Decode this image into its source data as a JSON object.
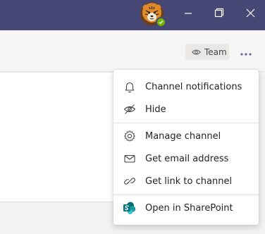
{
  "team_button": {
    "label": "Team",
    "icon": "eye-icon"
  },
  "more_button": {
    "icon": "more-dots-icon"
  },
  "presence": {
    "status_color": "#6bb700"
  },
  "menu": {
    "items": [
      {
        "label": "Channel notifications",
        "icon": "bell-icon"
      },
      {
        "label": "Hide",
        "icon": "eye-off-icon"
      },
      {
        "label": "Manage channel",
        "icon": "gear-icon"
      },
      {
        "label": "Get email address",
        "icon": "mail-icon"
      },
      {
        "label": "Get link to channel",
        "icon": "link-icon"
      },
      {
        "label": "Open in SharePoint",
        "icon": "sharepoint-icon"
      }
    ]
  },
  "colors": {
    "titlebar": "#464775",
    "accent": "#6264a7",
    "sharepoint": "#038387"
  }
}
